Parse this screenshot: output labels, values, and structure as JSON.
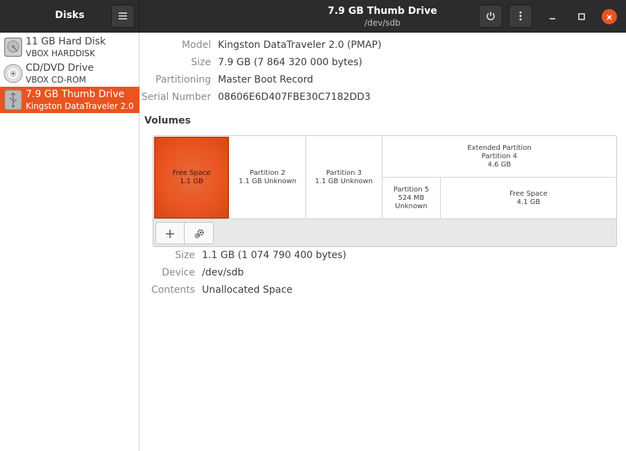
{
  "header": {
    "app_title": "Disks",
    "menu_icon": "hamburger-menu-icon",
    "window_title": "7.9 GB Thumb Drive",
    "window_subtitle": "/dev/sdb",
    "power_icon": "power-icon",
    "more_icon": "vertical-ellipsis-icon",
    "minimize_icon": "minimize-icon",
    "maximize_icon": "maximize-icon",
    "close_icon": "close-icon",
    "accent_color": "#e95420"
  },
  "sidebar": {
    "drives": [
      {
        "name": "11 GB Hard Disk",
        "model": "VBOX HARDDISK",
        "icon": "hard-disk-icon"
      },
      {
        "name": "CD/DVD Drive",
        "model": "VBOX CD-ROM",
        "icon": "optical-disc-icon"
      },
      {
        "name": "7.9 GB Thumb Drive",
        "model": "Kingston DataTraveler 2.0",
        "icon": "usb-drive-icon",
        "selected": true
      }
    ]
  },
  "drive_info": {
    "model_label": "Model",
    "model_value": "Kingston DataTraveler 2.0 (PMAP)",
    "size_label": "Size",
    "size_value": "7.9 GB (7 864 320 000 bytes)",
    "partitioning_label": "Partitioning",
    "partitioning_value": "Master Boot Record",
    "serial_label": "Serial Number",
    "serial_value": "08606E6D407FBE30C7182DD3"
  },
  "volumes": {
    "heading": "Volumes",
    "segments": {
      "free1": {
        "line1": "Free Space",
        "line2": "1.1 GB",
        "selected": true
      },
      "p2": {
        "line1": "Partition 2",
        "line2": "1.1 GB Unknown"
      },
      "p3": {
        "line1": "Partition 3",
        "line2": "1.1 GB Unknown"
      },
      "ext": {
        "line1": "Extended Partition",
        "line2": "Partition 4",
        "line3": "4.6 GB"
      },
      "p5": {
        "line1": "Partition 5",
        "line2": "524 MB Unknown"
      },
      "free2": {
        "line1": "Free Space",
        "line2": "4.1 GB"
      }
    },
    "add_icon": "plus-icon",
    "settings_icon": "gears-icon"
  },
  "selection_info": {
    "size_label": "Size",
    "size_value": "1.1 GB (1 074 790 400 bytes)",
    "device_label": "Device",
    "device_value": "/dev/sdb",
    "contents_label": "Contents",
    "contents_value": "Unallocated Space"
  }
}
